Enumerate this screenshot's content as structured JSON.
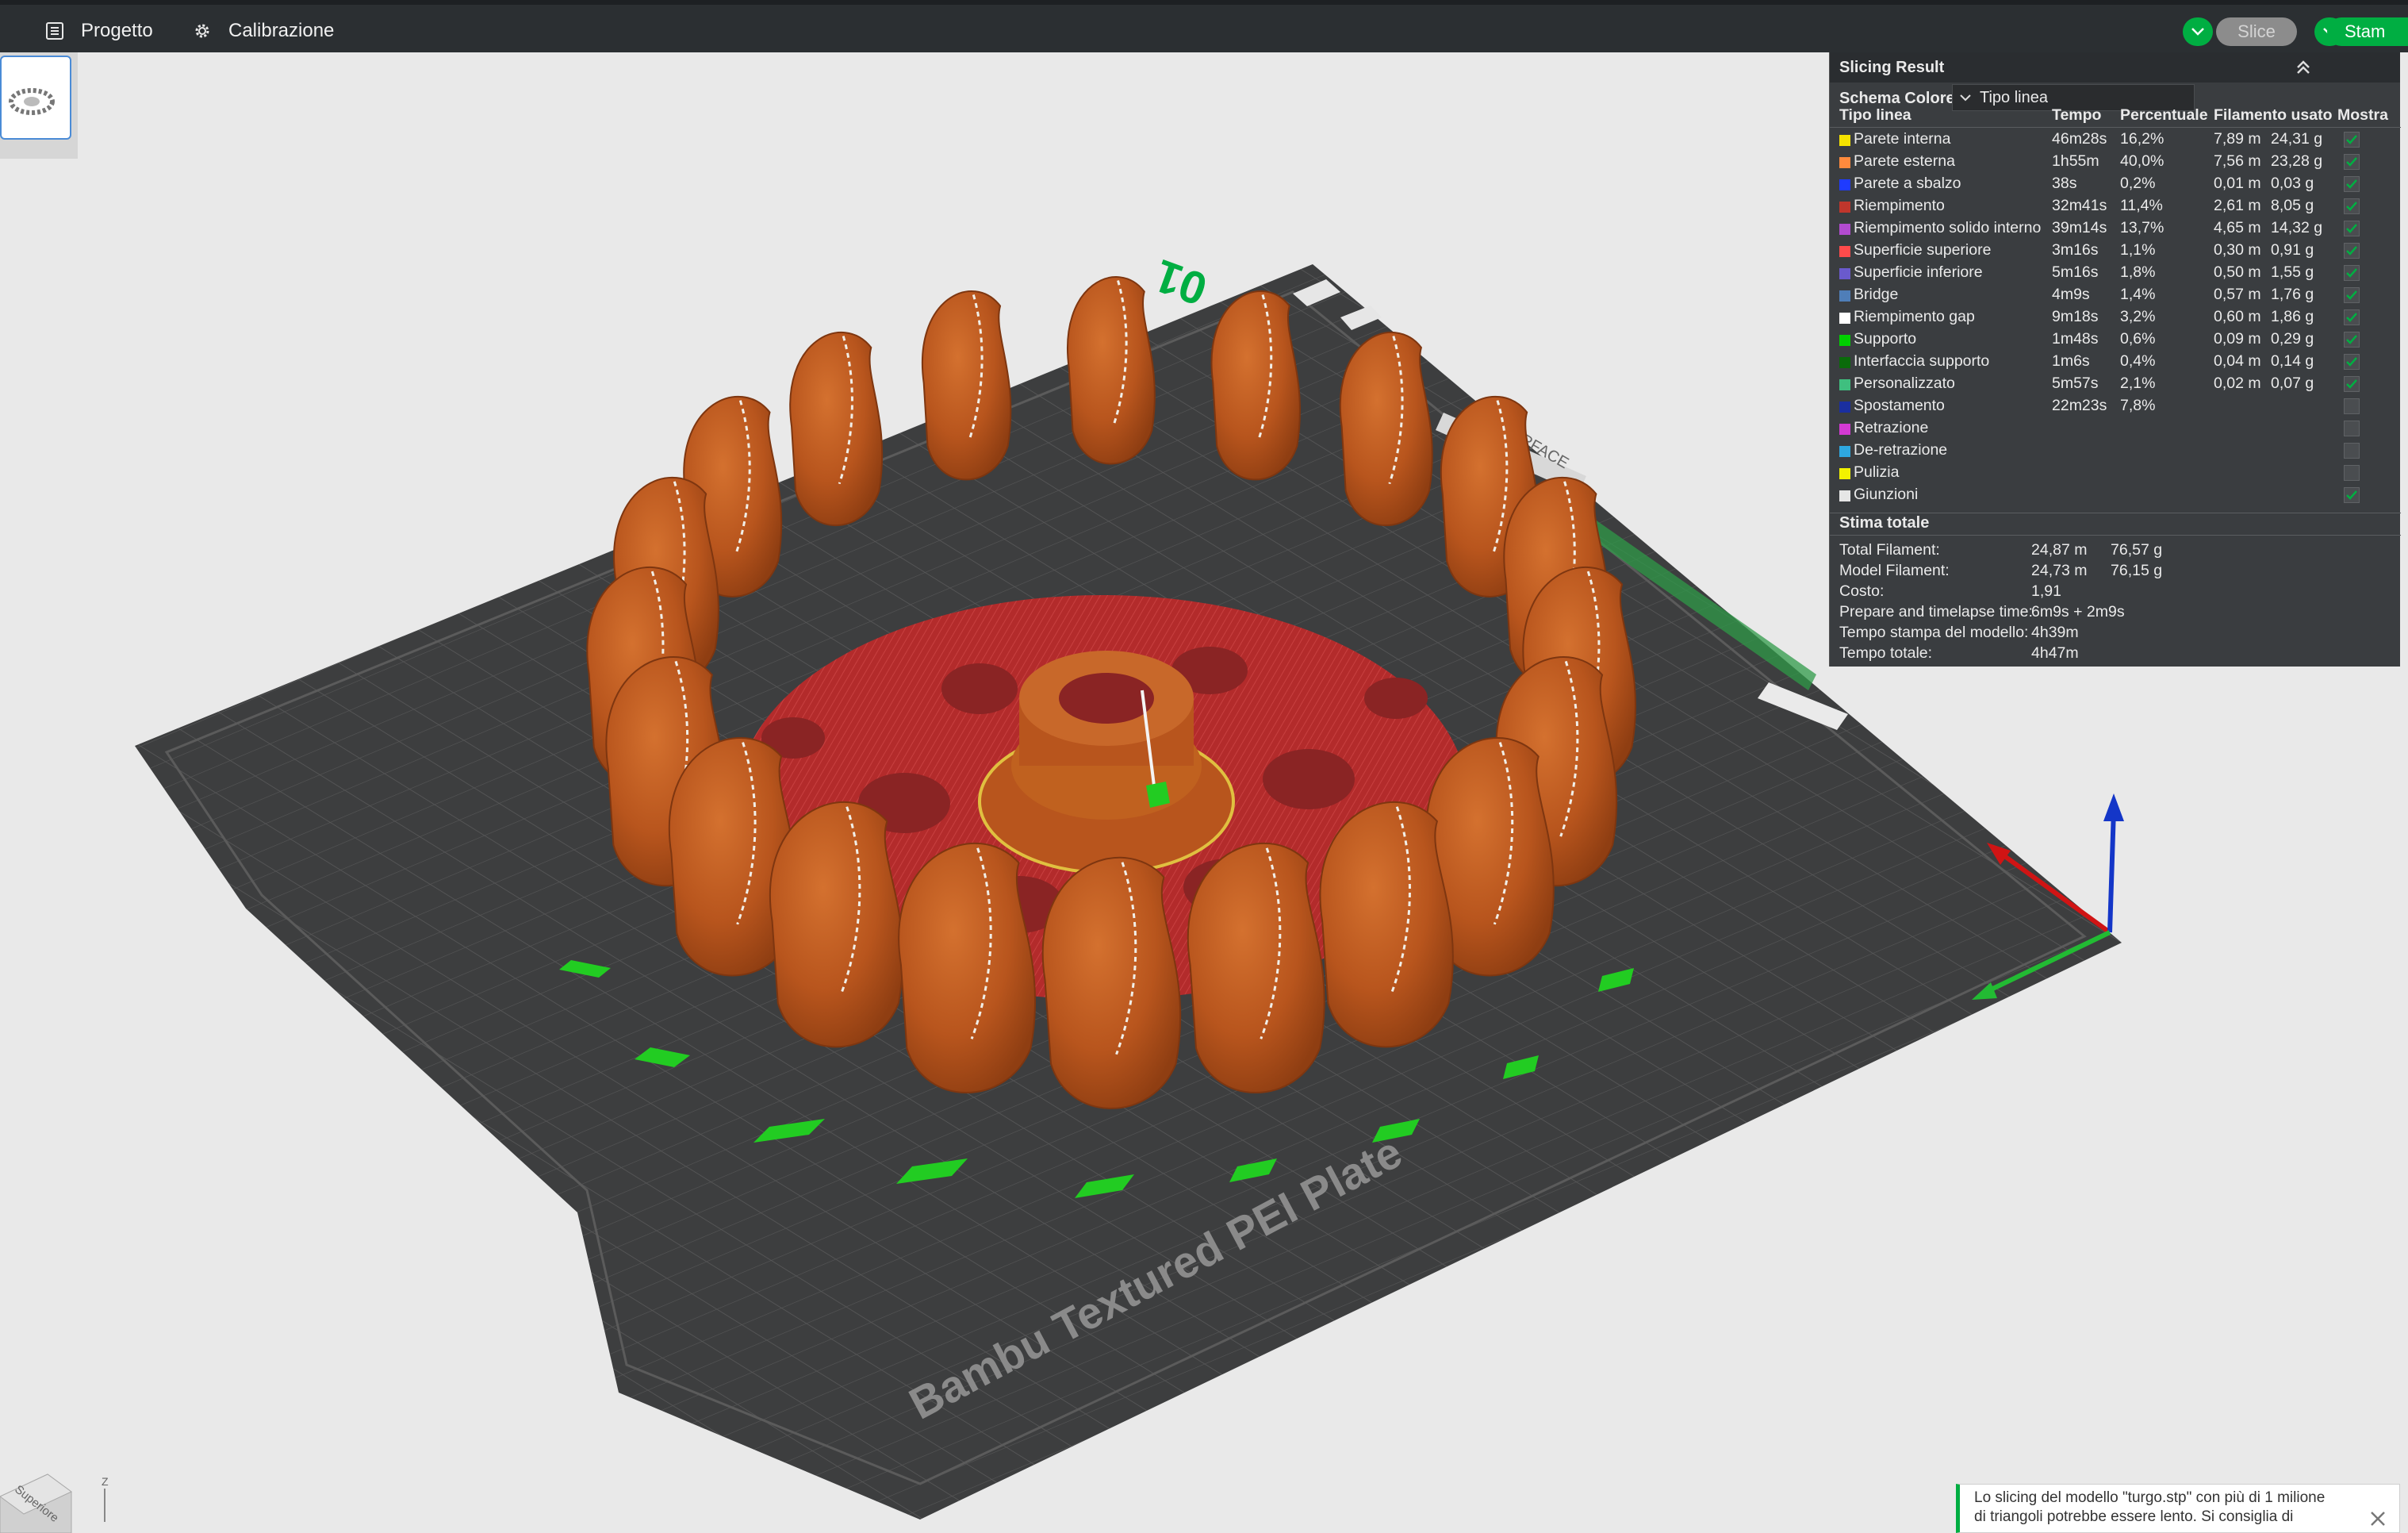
{
  "topbar": {
    "menu": [
      {
        "label": "Progetto",
        "icon": "project-icon"
      },
      {
        "label": "Calibrazione",
        "icon": "gear-icon"
      }
    ],
    "slice_label": "Slice",
    "print_label": "Stam"
  },
  "plate": {
    "number": "1"
  },
  "scene": {
    "plate_name": "Bambu Textured PEI Plate",
    "plate_index": "01",
    "plate_texts": [
      "HOT SURFACE"
    ]
  },
  "panel": {
    "title": "Slicing Result",
    "scheme_label": "Schema Colore",
    "scheme_value": "Tipo linea",
    "headers": [
      "Tipo linea",
      "Tempo",
      "Percentuale",
      "Filamento usato",
      "Mostra"
    ],
    "rows": [
      {
        "color": "#f5e300",
        "name": "Parete interna",
        "time": "46m28s",
        "pct": "16,2%",
        "len": "7,89 m",
        "wt": "24,31 g",
        "show": true
      },
      {
        "color": "#ff8a3d",
        "name": "Parete esterna",
        "time": "1h55m",
        "pct": "40,0%",
        "len": "7,56 m",
        "wt": "23,28 g",
        "show": true
      },
      {
        "color": "#1f3bff",
        "name": "Parete a sbalzo",
        "time": "38s",
        "pct": "0,2%",
        "len": "0,01 m",
        "wt": "0,03 g",
        "show": true
      },
      {
        "color": "#c0362c",
        "name": "Riempimento",
        "time": "32m41s",
        "pct": "11,4%",
        "len": "2,61 m",
        "wt": "8,05 g",
        "show": true
      },
      {
        "color": "#b24bd0",
        "name": "Riempimento solido interno",
        "time": "39m14s",
        "pct": "13,7%",
        "len": "4,65 m",
        "wt": "14,32 g",
        "show": true
      },
      {
        "color": "#ff4b4b",
        "name": "Superficie superiore",
        "time": "3m16s",
        "pct": "1,1%",
        "len": "0,30 m",
        "wt": "0,91 g",
        "show": true
      },
      {
        "color": "#6a5acd",
        "name": "Superficie inferiore",
        "time": "5m16s",
        "pct": "1,8%",
        "len": "0,50 m",
        "wt": "1,55 g",
        "show": true
      },
      {
        "color": "#4f7eb8",
        "name": "Bridge",
        "time": "4m9s",
        "pct": "1,4%",
        "len": "0,57 m",
        "wt": "1,76 g",
        "show": true
      },
      {
        "color": "#ffffff",
        "name": "Riempimento gap",
        "time": "9m18s",
        "pct": "3,2%",
        "len": "0,60 m",
        "wt": "1,86 g",
        "show": true
      },
      {
        "color": "#00d000",
        "name": "Supporto",
        "time": "1m48s",
        "pct": "0,6%",
        "len": "0,09 m",
        "wt": "0,29 g",
        "show": true
      },
      {
        "color": "#0a6b0a",
        "name": "Interfaccia supporto",
        "time": "1m6s",
        "pct": "0,4%",
        "len": "0,04 m",
        "wt": "0,14 g",
        "show": true
      },
      {
        "color": "#3fbf7f",
        "name": "Personalizzato",
        "time": "5m57s",
        "pct": "2,1%",
        "len": "0,02 m",
        "wt": "0,07 g",
        "show": true
      },
      {
        "color": "#1a2fa0",
        "name": "Spostamento",
        "time": "22m23s",
        "pct": "7,8%",
        "len": "",
        "wt": "",
        "show": false
      },
      {
        "color": "#d43ad4",
        "name": "Retrazione",
        "time": "",
        "pct": "",
        "len": "",
        "wt": "",
        "show": false
      },
      {
        "color": "#2ea8e0",
        "name": "De-retrazione",
        "time": "",
        "pct": "",
        "len": "",
        "wt": "",
        "show": false
      },
      {
        "color": "#f2f200",
        "name": "Pulizia",
        "time": "",
        "pct": "",
        "len": "",
        "wt": "",
        "show": false
      },
      {
        "color": "#e6e6e6",
        "name": "Giunzioni",
        "time": "",
        "pct": "",
        "len": "",
        "wt": "",
        "show": true
      }
    ],
    "summary_title": "Stima totale",
    "summary": [
      {
        "label": "Total Filament:",
        "v1": "24,87 m",
        "v2": "76,57 g"
      },
      {
        "label": "Model Filament:",
        "v1": "24,73 m",
        "v2": "76,15 g"
      },
      {
        "label": "Costo:",
        "v1": "1,91",
        "v2": ""
      },
      {
        "label": "Prepare and timelapse time:",
        "v1": "6m9s + 2m9s",
        "v2": ""
      },
      {
        "label": "Tempo stampa del modello:",
        "v1": "4h39m",
        "v2": ""
      },
      {
        "label": "Tempo totale:",
        "v1": "4h47m",
        "v2": ""
      }
    ]
  },
  "notification": {
    "lines": [
      "Lo slicing del modello \"turgo.stp\" con più di 1 milione",
      "di triangoli potrebbe essere lento. Si consiglia di"
    ]
  },
  "viewcube": {
    "face_label": "Superiore",
    "axis_label": "Z"
  },
  "colors": {
    "bed": "#3d3e3f",
    "model": "#b8551d",
    "infill": "#b02a2a",
    "support": "#22cc22",
    "accent": "#00ae42"
  }
}
